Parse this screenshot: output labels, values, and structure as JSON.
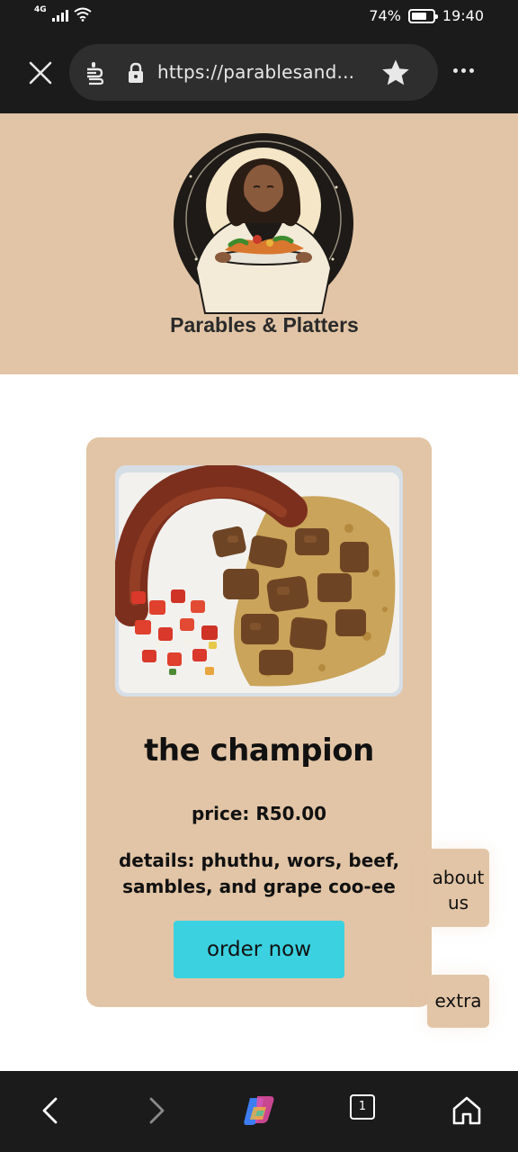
{
  "status_bar": {
    "network": "4G",
    "battery_percent": "74%",
    "battery_level": 0.74,
    "time": "19:40"
  },
  "browser": {
    "url": "https://parablesand...",
    "close_icon": "close-icon",
    "bookmark_icon": "star-icon",
    "menu_icon": "more-icon"
  },
  "header": {
    "brand_name": "Parables & Platters",
    "background": "#e2c5a6"
  },
  "product": {
    "title": "the champion",
    "price": "price: R50.00",
    "details": "details: phuthu, wors, beef, sambles, and grape coo-ee",
    "order_label": "order now",
    "button_color": "#3bd1e0"
  },
  "side_buttons": {
    "about_label": "about us",
    "extra_label": "extra"
  },
  "bottom_nav": {
    "tab_count": "1",
    "items": [
      "back-icon",
      "forward-icon",
      "copilot-icon",
      "tabs-icon",
      "home-icon"
    ]
  }
}
